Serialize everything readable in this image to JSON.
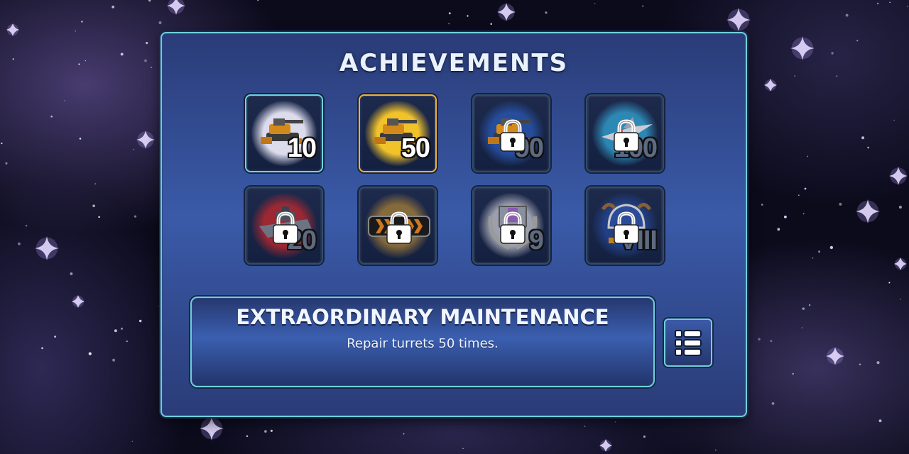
{
  "screen": {
    "title": "ACHIEVEMENTS"
  },
  "achievements": [
    {
      "icon": "turret-icon",
      "number": "10",
      "state": "unlocked",
      "glow": "#dcdcec"
    },
    {
      "icon": "turret-icon",
      "number": "50",
      "state": "unlocked-selected",
      "glow": "#f2c22a"
    },
    {
      "icon": "turret-icon",
      "number": "90",
      "state": "locked",
      "glow": "#2a5ab8"
    },
    {
      "icon": "spaceship-icon",
      "number": "100",
      "state": "locked",
      "glow": "#34a8d8"
    },
    {
      "icon": "battleship-icon",
      "number": "20",
      "state": "locked",
      "glow": "#c8282c"
    },
    {
      "icon": "rank-bar-icon",
      "number": "",
      "state": "locked",
      "glow": "#a88038"
    },
    {
      "icon": "trophy-shield-icon",
      "number": "9",
      "state": "locked",
      "glow": "#c8c8d0"
    },
    {
      "icon": "helmet-icon",
      "number": "VIII",
      "state": "locked",
      "glow": "#24489a"
    }
  ],
  "selected_achievement": {
    "title": "EXTRAORDINARY MAINTENANCE",
    "description": "Repair turrets 50 times."
  },
  "list_button": {
    "icon": "list-icon"
  },
  "colors": {
    "panel_border": "#6fcfd8",
    "selected_border": "#f0b23a",
    "panel_fill": "#3a5aa8"
  }
}
